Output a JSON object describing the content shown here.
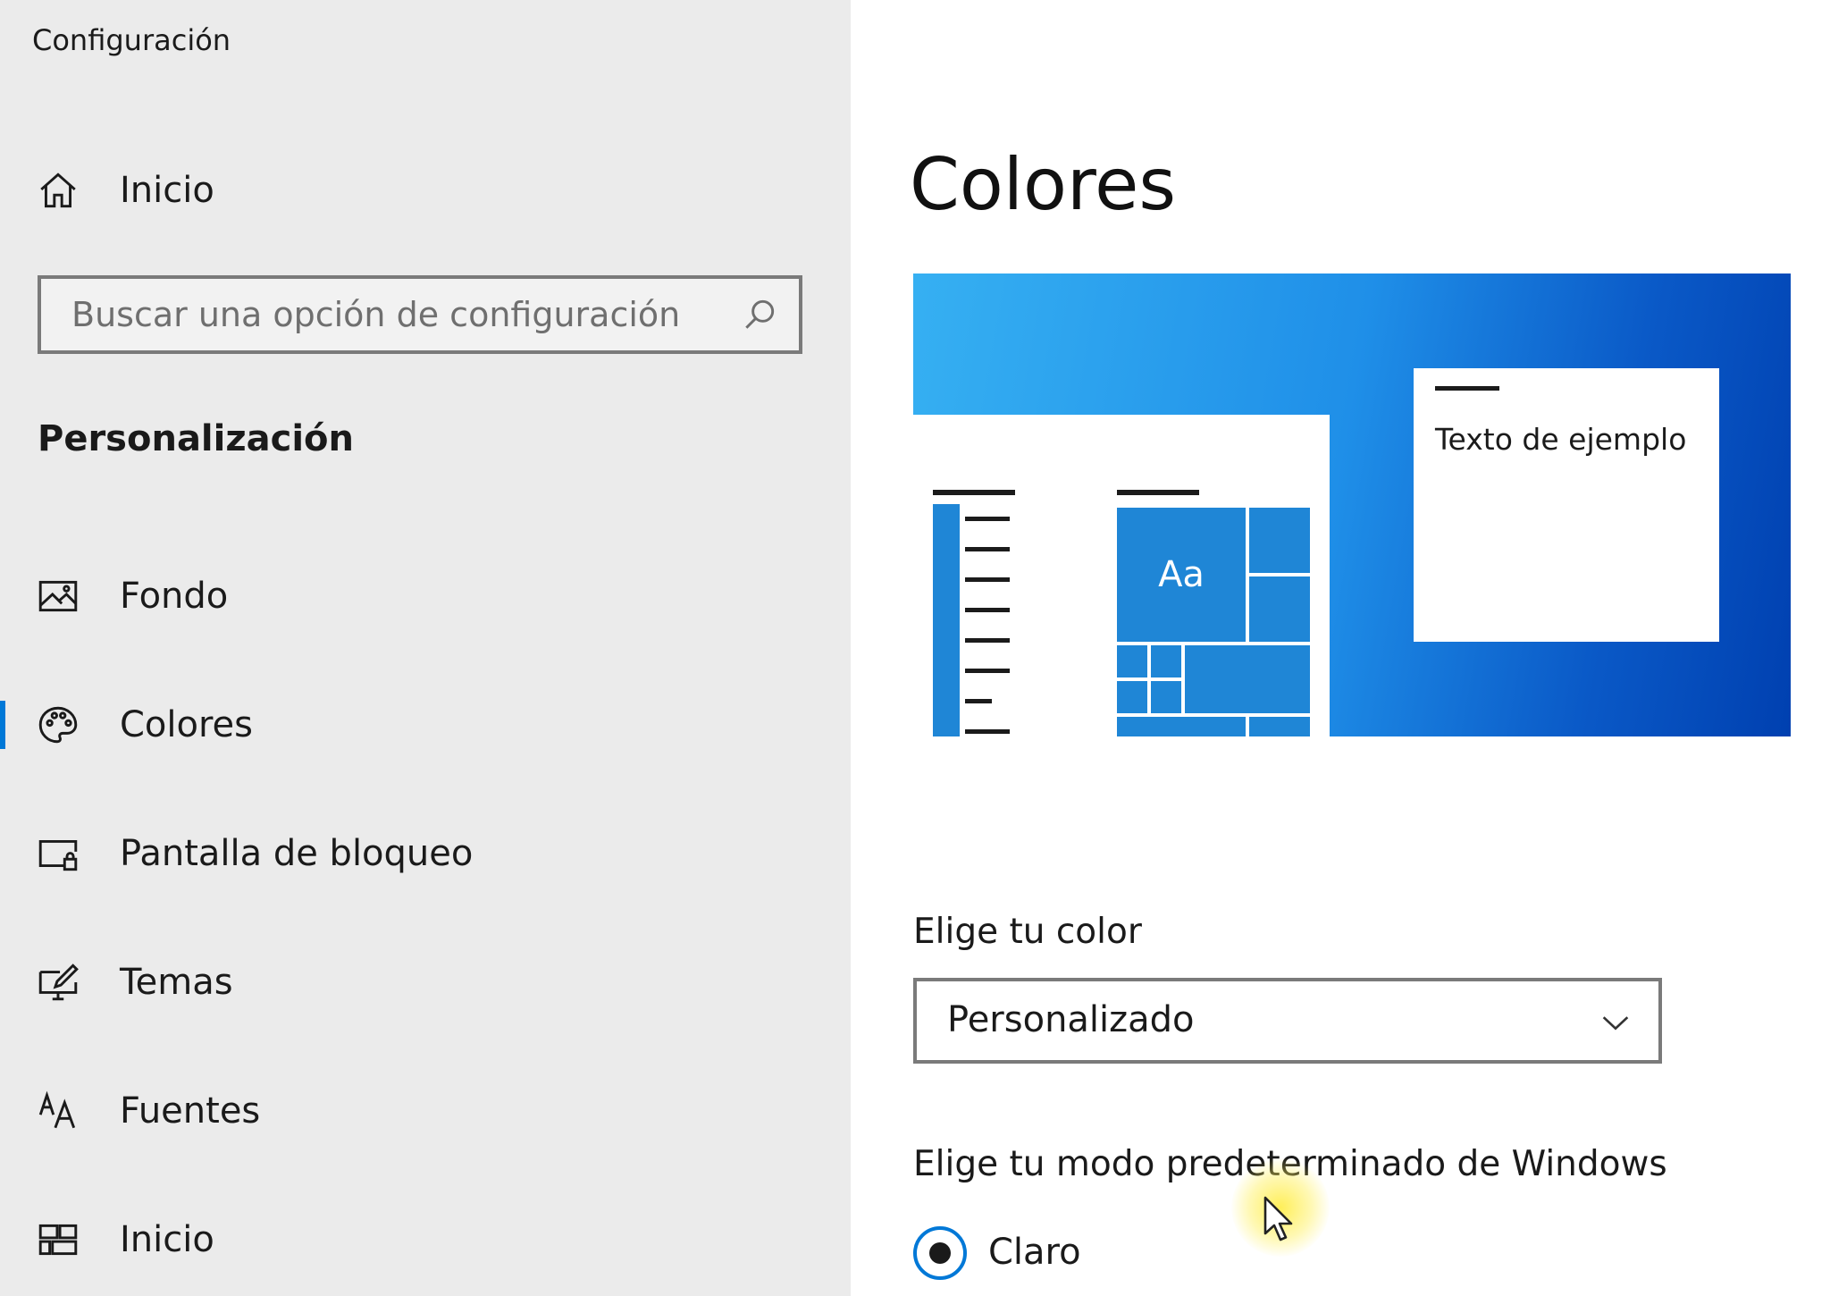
{
  "app": {
    "title": "Configuración"
  },
  "sidebar": {
    "home": {
      "label": "Inicio",
      "icon": "home-icon"
    },
    "search": {
      "placeholder": "Buscar una opción de configuración",
      "icon": "search-icon"
    },
    "section_title": "Personalización",
    "items": [
      {
        "label": "Fondo",
        "icon": "image-icon",
        "active": false
      },
      {
        "label": "Colores",
        "icon": "palette-icon",
        "active": true
      },
      {
        "label": "Pantalla de bloqueo",
        "icon": "lock-screen-icon",
        "active": false
      },
      {
        "label": "Temas",
        "icon": "themes-icon",
        "active": false
      },
      {
        "label": "Fuentes",
        "icon": "fonts-icon",
        "active": false
      },
      {
        "label": "Inicio",
        "icon": "start-icon",
        "active": false
      }
    ]
  },
  "main": {
    "title": "Colores",
    "preview": {
      "tile_text": "Aa",
      "sample_text": "Texto de ejemplo"
    },
    "choose_color": {
      "label": "Elige tu color",
      "selected": "Personalizado"
    },
    "windows_mode": {
      "label": "Elige tu modo predeterminado de Windows",
      "option": "Claro",
      "selected": true
    }
  },
  "colors": {
    "accent": "#0078d7",
    "sidebar_bg": "#ebebeb",
    "tile_blue": "#1f86d6",
    "preview_gradient": [
      "#36b0f2",
      "#1f8fe8",
      "#0a59c7",
      "#0040b0"
    ]
  }
}
